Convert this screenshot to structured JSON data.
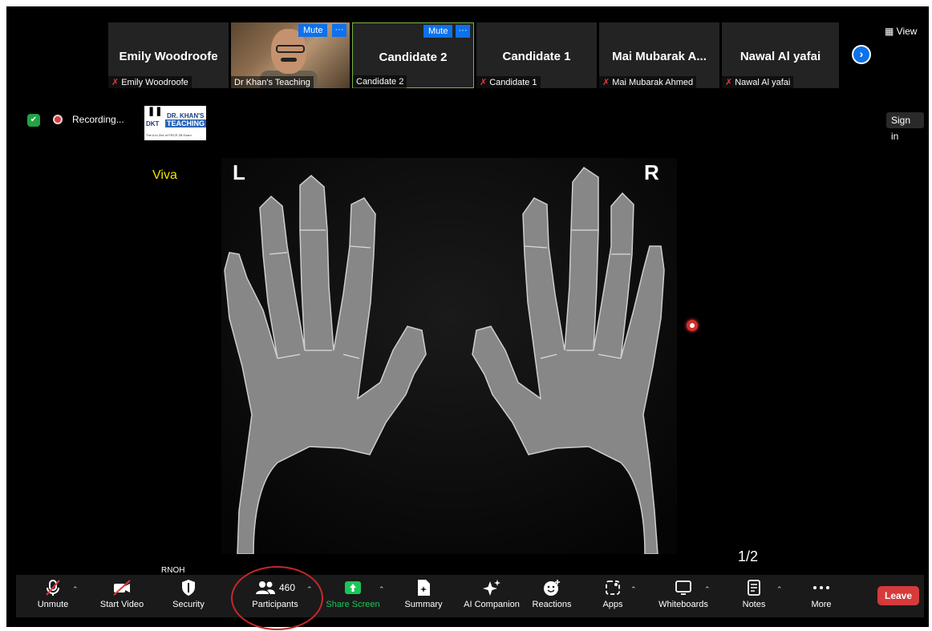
{
  "window": {
    "view_label": "View",
    "sign_in_label": "Sign in"
  },
  "participants_strip": {
    "tiles": [
      {
        "display_name": "Emily Woodroofe",
        "label": "Emily Woodroofe",
        "muted": true
      },
      {
        "display_name": "",
        "label": "Dr Khan's Teaching",
        "muted": false,
        "has_video": true
      },
      {
        "display_name": "Candidate 2",
        "label": "Candidate 2",
        "muted": false
      },
      {
        "display_name": "Candidate 1",
        "label": "Candidate 1",
        "muted": true
      },
      {
        "display_name": "Mai Mubarak A...",
        "label": "Mai Mubarak Ahmed",
        "muted": true
      },
      {
        "display_name": "Nawal Al yafai",
        "label": "Nawal Al yafai",
        "muted": true
      }
    ],
    "mute_label": "Mute",
    "more_label": "···"
  },
  "status": {
    "recording_label": "Recording..."
  },
  "logo": {
    "line1": "DR. KHAN'S",
    "line2": "DKT",
    "line3": "TEACHING",
    "line4": "The A to Zee of FRCR 2B Exam"
  },
  "slide": {
    "title": "Viva",
    "left_marker": "L",
    "right_marker": "R",
    "page": "1/2",
    "caption": "RNOH"
  },
  "toolbar": {
    "unmute": "Unmute",
    "start_video": "Start Video",
    "security": "Security",
    "participants": "Participants",
    "participants_count": "460",
    "share_screen": "Share Screen",
    "summary": "Summary",
    "ai_companion": "AI Companion",
    "reactions": "Reactions",
    "apps": "Apps",
    "whiteboards": "Whiteboards",
    "notes": "Notes",
    "more": "More",
    "leave": "Leave"
  },
  "colors": {
    "accent": "#0e71eb",
    "leave": "#d63a3a",
    "share_green": "#1ec45a",
    "viva_yellow": "#f2e300",
    "annotation_red": "#c62828"
  }
}
